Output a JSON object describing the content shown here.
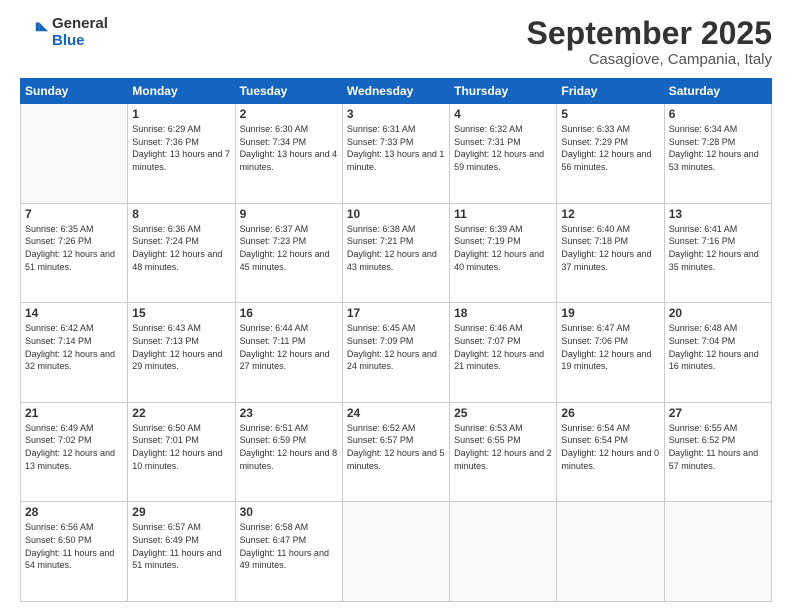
{
  "logo": {
    "general": "General",
    "blue": "Blue"
  },
  "header": {
    "month": "September 2025",
    "location": "Casagiove, Campania, Italy"
  },
  "weekdays": [
    "Sunday",
    "Monday",
    "Tuesday",
    "Wednesday",
    "Thursday",
    "Friday",
    "Saturday"
  ],
  "weeks": [
    [
      {
        "day": "",
        "sunrise": "",
        "sunset": "",
        "daylight": ""
      },
      {
        "day": "1",
        "sunrise": "Sunrise: 6:29 AM",
        "sunset": "Sunset: 7:36 PM",
        "daylight": "Daylight: 13 hours and 7 minutes."
      },
      {
        "day": "2",
        "sunrise": "Sunrise: 6:30 AM",
        "sunset": "Sunset: 7:34 PM",
        "daylight": "Daylight: 13 hours and 4 minutes."
      },
      {
        "day": "3",
        "sunrise": "Sunrise: 6:31 AM",
        "sunset": "Sunset: 7:33 PM",
        "daylight": "Daylight: 13 hours and 1 minute."
      },
      {
        "day": "4",
        "sunrise": "Sunrise: 6:32 AM",
        "sunset": "Sunset: 7:31 PM",
        "daylight": "Daylight: 12 hours and 59 minutes."
      },
      {
        "day": "5",
        "sunrise": "Sunrise: 6:33 AM",
        "sunset": "Sunset: 7:29 PM",
        "daylight": "Daylight: 12 hours and 56 minutes."
      },
      {
        "day": "6",
        "sunrise": "Sunrise: 6:34 AM",
        "sunset": "Sunset: 7:28 PM",
        "daylight": "Daylight: 12 hours and 53 minutes."
      }
    ],
    [
      {
        "day": "7",
        "sunrise": "Sunrise: 6:35 AM",
        "sunset": "Sunset: 7:26 PM",
        "daylight": "Daylight: 12 hours and 51 minutes."
      },
      {
        "day": "8",
        "sunrise": "Sunrise: 6:36 AM",
        "sunset": "Sunset: 7:24 PM",
        "daylight": "Daylight: 12 hours and 48 minutes."
      },
      {
        "day": "9",
        "sunrise": "Sunrise: 6:37 AM",
        "sunset": "Sunset: 7:23 PM",
        "daylight": "Daylight: 12 hours and 45 minutes."
      },
      {
        "day": "10",
        "sunrise": "Sunrise: 6:38 AM",
        "sunset": "Sunset: 7:21 PM",
        "daylight": "Daylight: 12 hours and 43 minutes."
      },
      {
        "day": "11",
        "sunrise": "Sunrise: 6:39 AM",
        "sunset": "Sunset: 7:19 PM",
        "daylight": "Daylight: 12 hours and 40 minutes."
      },
      {
        "day": "12",
        "sunrise": "Sunrise: 6:40 AM",
        "sunset": "Sunset: 7:18 PM",
        "daylight": "Daylight: 12 hours and 37 minutes."
      },
      {
        "day": "13",
        "sunrise": "Sunrise: 6:41 AM",
        "sunset": "Sunset: 7:16 PM",
        "daylight": "Daylight: 12 hours and 35 minutes."
      }
    ],
    [
      {
        "day": "14",
        "sunrise": "Sunrise: 6:42 AM",
        "sunset": "Sunset: 7:14 PM",
        "daylight": "Daylight: 12 hours and 32 minutes."
      },
      {
        "day": "15",
        "sunrise": "Sunrise: 6:43 AM",
        "sunset": "Sunset: 7:13 PM",
        "daylight": "Daylight: 12 hours and 29 minutes."
      },
      {
        "day": "16",
        "sunrise": "Sunrise: 6:44 AM",
        "sunset": "Sunset: 7:11 PM",
        "daylight": "Daylight: 12 hours and 27 minutes."
      },
      {
        "day": "17",
        "sunrise": "Sunrise: 6:45 AM",
        "sunset": "Sunset: 7:09 PM",
        "daylight": "Daylight: 12 hours and 24 minutes."
      },
      {
        "day": "18",
        "sunrise": "Sunrise: 6:46 AM",
        "sunset": "Sunset: 7:07 PM",
        "daylight": "Daylight: 12 hours and 21 minutes."
      },
      {
        "day": "19",
        "sunrise": "Sunrise: 6:47 AM",
        "sunset": "Sunset: 7:06 PM",
        "daylight": "Daylight: 12 hours and 19 minutes."
      },
      {
        "day": "20",
        "sunrise": "Sunrise: 6:48 AM",
        "sunset": "Sunset: 7:04 PM",
        "daylight": "Daylight: 12 hours and 16 minutes."
      }
    ],
    [
      {
        "day": "21",
        "sunrise": "Sunrise: 6:49 AM",
        "sunset": "Sunset: 7:02 PM",
        "daylight": "Daylight: 12 hours and 13 minutes."
      },
      {
        "day": "22",
        "sunrise": "Sunrise: 6:50 AM",
        "sunset": "Sunset: 7:01 PM",
        "daylight": "Daylight: 12 hours and 10 minutes."
      },
      {
        "day": "23",
        "sunrise": "Sunrise: 6:51 AM",
        "sunset": "Sunset: 6:59 PM",
        "daylight": "Daylight: 12 hours and 8 minutes."
      },
      {
        "day": "24",
        "sunrise": "Sunrise: 6:52 AM",
        "sunset": "Sunset: 6:57 PM",
        "daylight": "Daylight: 12 hours and 5 minutes."
      },
      {
        "day": "25",
        "sunrise": "Sunrise: 6:53 AM",
        "sunset": "Sunset: 6:55 PM",
        "daylight": "Daylight: 12 hours and 2 minutes."
      },
      {
        "day": "26",
        "sunrise": "Sunrise: 6:54 AM",
        "sunset": "Sunset: 6:54 PM",
        "daylight": "Daylight: 12 hours and 0 minutes."
      },
      {
        "day": "27",
        "sunrise": "Sunrise: 6:55 AM",
        "sunset": "Sunset: 6:52 PM",
        "daylight": "Daylight: 11 hours and 57 minutes."
      }
    ],
    [
      {
        "day": "28",
        "sunrise": "Sunrise: 6:56 AM",
        "sunset": "Sunset: 6:50 PM",
        "daylight": "Daylight: 11 hours and 54 minutes."
      },
      {
        "day": "29",
        "sunrise": "Sunrise: 6:57 AM",
        "sunset": "Sunset: 6:49 PM",
        "daylight": "Daylight: 11 hours and 51 minutes."
      },
      {
        "day": "30",
        "sunrise": "Sunrise: 6:58 AM",
        "sunset": "Sunset: 6:47 PM",
        "daylight": "Daylight: 11 hours and 49 minutes."
      },
      {
        "day": "",
        "sunrise": "",
        "sunset": "",
        "daylight": ""
      },
      {
        "day": "",
        "sunrise": "",
        "sunset": "",
        "daylight": ""
      },
      {
        "day": "",
        "sunrise": "",
        "sunset": "",
        "daylight": ""
      },
      {
        "day": "",
        "sunrise": "",
        "sunset": "",
        "daylight": ""
      }
    ]
  ]
}
